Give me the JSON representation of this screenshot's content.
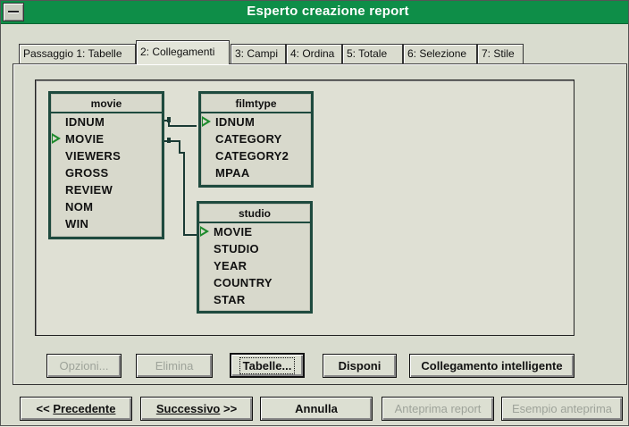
{
  "window": {
    "title": "Esperto creazione report"
  },
  "tabs": [
    {
      "label": "Passaggio 1: Tabelle",
      "active": false
    },
    {
      "label": "2: Collegamenti",
      "active": true
    },
    {
      "label": "3: Campi",
      "active": false
    },
    {
      "label": "4: Ordina",
      "active": false
    },
    {
      "label": "5: Totale",
      "active": false
    },
    {
      "label": "6: Selezione",
      "active": false
    },
    {
      "label": "7: Stile",
      "active": false
    }
  ],
  "tables": {
    "movie": {
      "name": "movie",
      "fields": [
        "IDNUM",
        "MOVIE",
        "VIEWERS",
        "GROSS",
        "REVIEW",
        "NOM",
        "WIN"
      ]
    },
    "filmtype": {
      "name": "filmtype",
      "fields": [
        "IDNUM",
        "CATEGORY",
        "CATEGORY2",
        "MPAA"
      ]
    },
    "studio": {
      "name": "studio",
      "fields": [
        "MOVIE",
        "STUDIO",
        "YEAR",
        "COUNTRY",
        "STAR"
      ]
    }
  },
  "panel_buttons": {
    "opzioni": "Opzioni...",
    "elimina": "Elimina",
    "tabelle": "Tabelle...",
    "disponi": "Disponi",
    "collegamento": "Collegamento intelligente"
  },
  "nav_buttons": {
    "precedente_prefix": "<< ",
    "precedente": "Precedente",
    "successivo": "Successivo",
    "successivo_suffix": " >>",
    "annulla": "Annulla",
    "anteprima_report": "Anteprima report",
    "esempio_anteprima": "Esempio anteprima"
  },
  "colors": {
    "titlebar": "#0e8e48",
    "table_border": "#1e4a3e",
    "key_marker": "#1d8a2c"
  }
}
